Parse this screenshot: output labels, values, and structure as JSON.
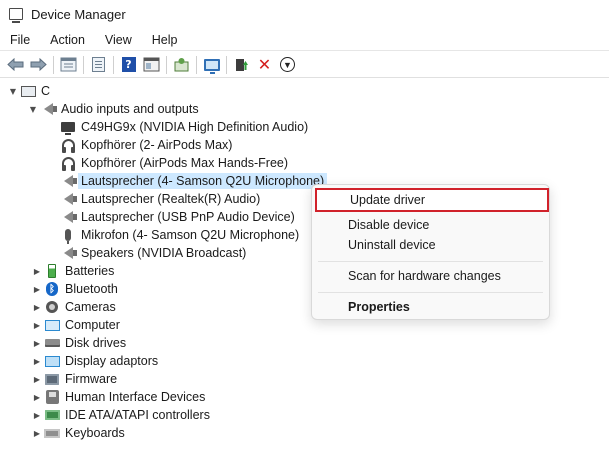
{
  "window": {
    "title": "Device Manager",
    "icon": "device-manager-icon"
  },
  "menu": [
    {
      "label": "File"
    },
    {
      "label": "Action"
    },
    {
      "label": "View"
    },
    {
      "label": "Help"
    }
  ],
  "toolbar": {
    "buttons": [
      "back-arrow-icon",
      "forward-arrow-icon",
      "properties-icon",
      "document-icon",
      "help-icon",
      "window-icon",
      "scan-hardware-icon",
      "monitor-icon",
      "update-driver-icon",
      "uninstall-x-icon",
      "download-arrow-icon"
    ]
  },
  "tree": {
    "root": {
      "label": "C",
      "icon": "computer-icon",
      "expanded": true
    },
    "audio": {
      "label": "Audio inputs and outputs",
      "icon": "speaker-icon",
      "expanded": true,
      "children": [
        {
          "label": "C49HG9x (NVIDIA High Definition Audio)",
          "icon": "monitor-icon"
        },
        {
          "label": "Kopfhörer (2- AirPods Max)",
          "icon": "headphone-icon"
        },
        {
          "label": "Kopfhörer (AirPods Max Hands-Free)",
          "icon": "headphone-icon"
        },
        {
          "label": "Lautsprecher (4- Samson Q2U Microphone)",
          "icon": "speaker-icon",
          "selected": true
        },
        {
          "label": "Lautsprecher (Realtek(R) Audio)",
          "icon": "speaker-icon"
        },
        {
          "label": "Lautsprecher (USB PnP Audio Device)",
          "icon": "speaker-icon"
        },
        {
          "label": "Mikrofon (4- Samson Q2U Microphone)",
          "icon": "microphone-icon"
        },
        {
          "label": "Speakers (NVIDIA Broadcast)",
          "icon": "speaker-icon"
        }
      ]
    },
    "categories": [
      {
        "label": "Batteries",
        "icon": "battery-icon"
      },
      {
        "label": "Bluetooth",
        "icon": "bluetooth-icon"
      },
      {
        "label": "Cameras",
        "icon": "camera-icon"
      },
      {
        "label": "Computer",
        "icon": "computer-icon"
      },
      {
        "label": "Disk drives",
        "icon": "disk-drive-icon"
      },
      {
        "label": "Display adaptors",
        "icon": "display-adapter-icon"
      },
      {
        "label": "Firmware",
        "icon": "firmware-icon"
      },
      {
        "label": "Human Interface Devices",
        "icon": "hid-icon"
      },
      {
        "label": "IDE ATA/ATAPI controllers",
        "icon": "ide-controller-icon"
      },
      {
        "label": "Keyboards",
        "icon": "keyboard-icon"
      }
    ]
  },
  "context_menu": {
    "items": [
      {
        "label": "Update driver",
        "highlighted": true
      },
      {
        "label": "Disable device"
      },
      {
        "label": "Uninstall device"
      },
      {
        "label": "Scan for hardware changes"
      },
      {
        "label": "Properties",
        "bold": true
      }
    ],
    "highlight_color": "#d1222b"
  },
  "colors": {
    "selection": "#cde8ff",
    "accent_red": "#d1222b"
  }
}
